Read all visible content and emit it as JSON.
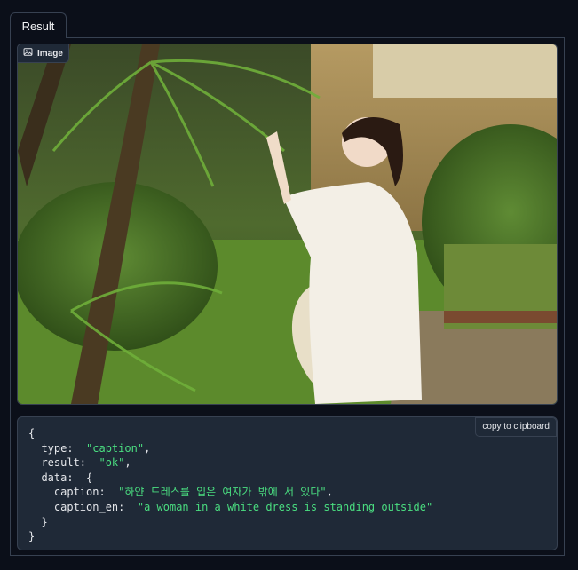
{
  "tab": {
    "label": "Result"
  },
  "image_panel": {
    "label": "Image",
    "icon": "image-icon",
    "description": "woman-in-white-dress-garden-photo"
  },
  "json_output": {
    "copy_label": "copy to clipboard",
    "open_brace": "{",
    "close_brace": "}",
    "type_key": "type:",
    "type_value": "\"caption\"",
    "result_key": "result:",
    "result_value": "\"ok\"",
    "data_key": "data:",
    "caption_key": "caption:",
    "caption_value": "\"하얀 드레스를 입은 여자가 밖에 서 있다\"",
    "caption_en_key": "caption_en:",
    "caption_en_value": "\"a woman in a white dress is standing outside\""
  }
}
